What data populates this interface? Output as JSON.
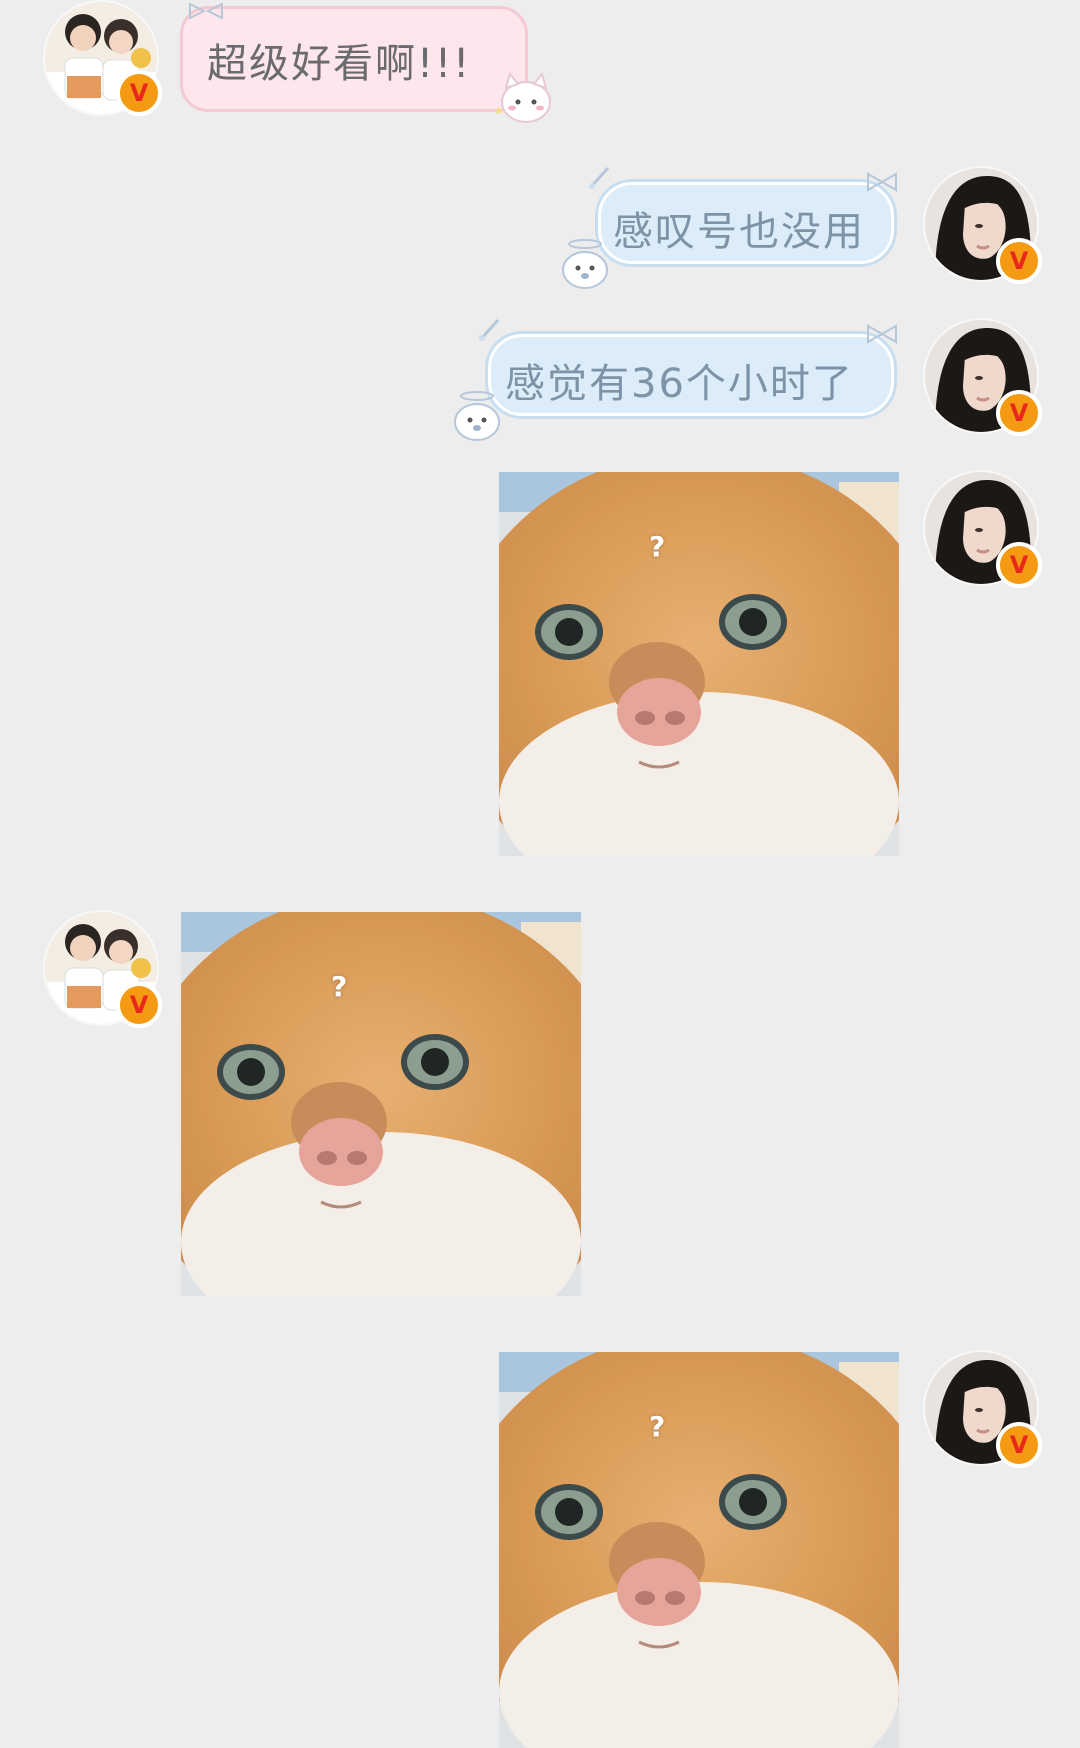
{
  "chat": {
    "messages": [
      {
        "sender": "other",
        "type": "text",
        "text": "超级好看啊!!!"
      },
      {
        "sender": "self",
        "type": "text",
        "text": "感叹号也没用"
      },
      {
        "sender": "self",
        "type": "text",
        "text": "感觉有36个小时了"
      },
      {
        "sender": "self",
        "type": "sticker",
        "sticker": "cat-question-sticker",
        "overlay_text": "?"
      },
      {
        "sender": "other",
        "type": "sticker",
        "sticker": "cat-question-sticker",
        "overlay_text": "?"
      },
      {
        "sender": "self",
        "type": "sticker",
        "sticker": "cat-question-sticker",
        "overlay_text": "?"
      }
    ],
    "verified_badge": "V"
  },
  "colors": {
    "background": "#ededed",
    "pink_bubble": "#fde7ec",
    "blue_bubble": "#dcecf8",
    "badge": "#f59b13"
  }
}
